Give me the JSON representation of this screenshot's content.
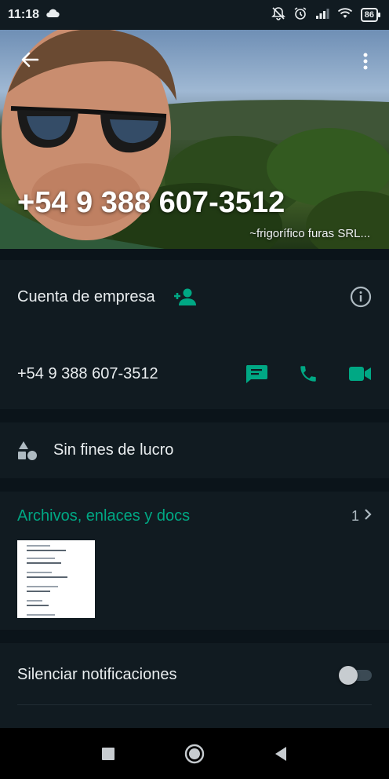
{
  "status_bar": {
    "time": "11:18",
    "battery": "86",
    "icons": [
      "cloud-icon",
      "notifications-off-icon",
      "alarm-icon",
      "signal-icon",
      "wifi-icon",
      "battery-icon"
    ]
  },
  "header": {
    "phone": "+54 9 388 607-3512",
    "push_name": "~frigorífico furas SRL...",
    "back_icon": "arrow-back-icon",
    "menu_icon": "more-vert-icon"
  },
  "business": {
    "label": "Cuenta de empresa",
    "add_icon": "person-add-icon",
    "info_icon": "info-icon"
  },
  "phone_row": {
    "number": "+54 9 388 607-3512",
    "actions": [
      "message-icon",
      "call-icon",
      "video-call-icon"
    ]
  },
  "category": {
    "label": "Sin fines de lucro",
    "icon": "category-shapes-icon"
  },
  "media": {
    "title": "Archivos, enlaces y docs",
    "count": "1"
  },
  "mute": {
    "label": "Silenciar notificaciones",
    "enabled": false
  },
  "navigation": {
    "buttons": [
      "recents-icon",
      "home-icon",
      "back-icon"
    ]
  },
  "colors": {
    "accent": "#00a884",
    "background": "#0b141a",
    "surface": "#111b21",
    "text_primary": "#e9edef",
    "text_secondary": "#aebac1"
  }
}
